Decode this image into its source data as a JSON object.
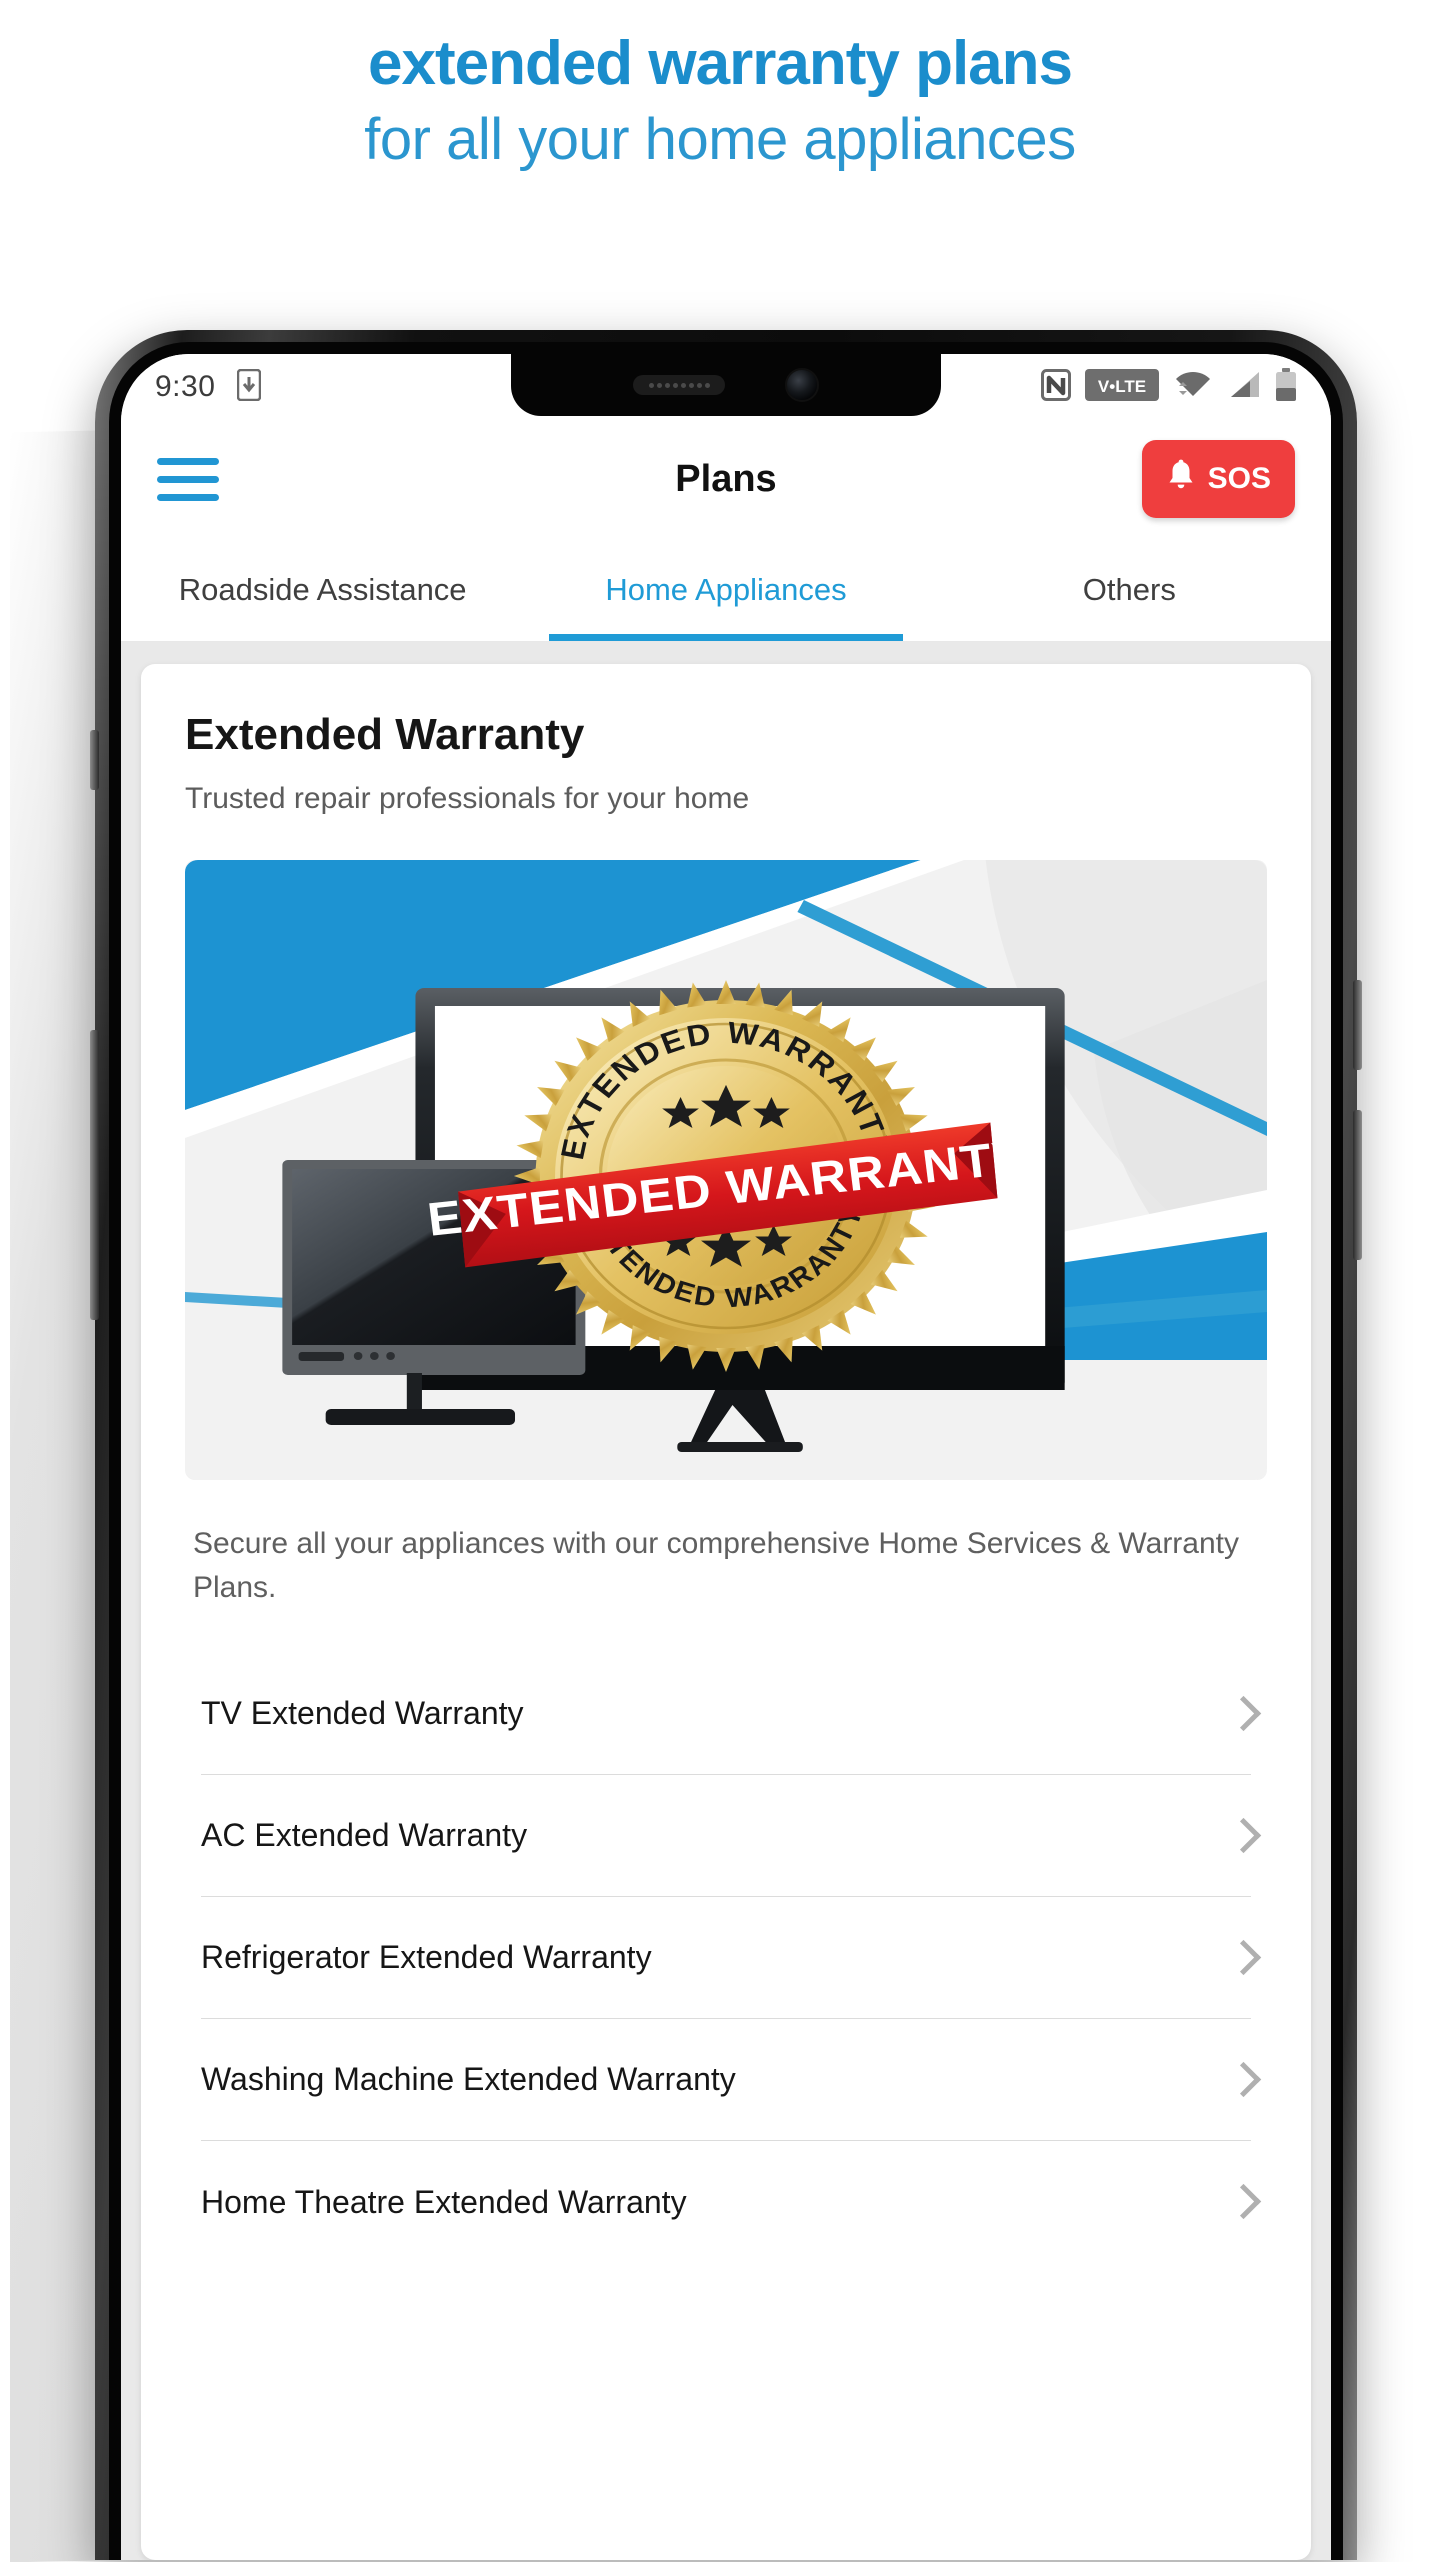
{
  "hero": {
    "line1": "extended warranty plans",
    "line2": "for all your home appliances",
    "accent_color": "#1b8dcc"
  },
  "statusbar": {
    "time": "9:30",
    "left_icons": [
      "phone-download-icon"
    ],
    "right_icons": [
      "nfc-icon",
      "volte-badge",
      "wifi-icon",
      "cellular-signal-icon",
      "battery-icon"
    ],
    "volte_label": "VoLTE"
  },
  "appbar": {
    "menu_icon": "hamburger-menu-icon",
    "title": "Plans",
    "sos_label": "SOS",
    "sos_icon": "bell-icon",
    "sos_color": "#ef3e3e"
  },
  "tabs": [
    {
      "label": "Roadside Assistance",
      "active": false
    },
    {
      "label": "Home Appliances",
      "active": true
    },
    {
      "label": "Others",
      "active": false
    }
  ],
  "card": {
    "title": "Extended Warranty",
    "subtitle": "Trusted repair professionals for your home",
    "description": "Secure all your appliances with our comprehensive Home Services & Warranty Plans."
  },
  "banner": {
    "seal_top_text": "EXTENDED WARRANTY",
    "seal_bottom_text": "EXTENDED WARRANTY",
    "ribbon_text": "EXTENDED WARRANTY",
    "accent_blue": "#1d93d2",
    "ribbon_red": "#d81f23",
    "gold": "#d8b451"
  },
  "plans": [
    {
      "label": "TV Extended Warranty",
      "chevron": "chevron-right-icon"
    },
    {
      "label": "AC Extended Warranty",
      "chevron": "chevron-right-icon"
    },
    {
      "label": "Refrigerator Extended Warranty",
      "chevron": "chevron-right-icon"
    },
    {
      "label": "Washing Machine Extended Warranty",
      "chevron": "chevron-right-icon"
    },
    {
      "label": "Home Theatre Extended Warranty",
      "chevron": "chevron-right-icon"
    }
  ]
}
